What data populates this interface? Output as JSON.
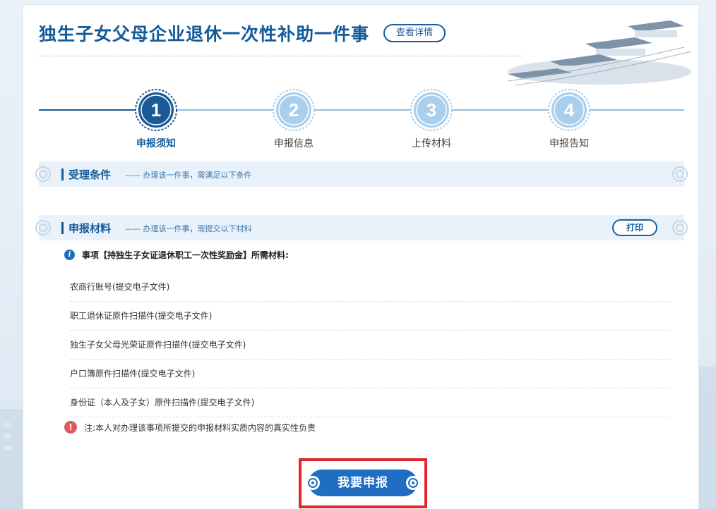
{
  "page": {
    "title": "独生子女父母企业退休一次性补助一件事",
    "detail_button": "查看详情"
  },
  "steps": [
    {
      "number": "1",
      "label": "申报须知",
      "active": true
    },
    {
      "number": "2",
      "label": "申报信息",
      "active": false
    },
    {
      "number": "3",
      "label": "上传材料",
      "active": false
    },
    {
      "number": "4",
      "label": "申报告知",
      "active": false
    }
  ],
  "conditions": {
    "title": "受理条件",
    "description": "—— 办理该一件事，需满足以下条件"
  },
  "materials": {
    "title": "申报材料",
    "description": "—— 办理该一件事，需提交以下材料",
    "print_button": "打印",
    "item_header": "事项【持独生子女证退休职工一次性奖励金】所需材料:",
    "items": [
      "农商行账号(提交电子文件)",
      "职工退休证原件扫描件(提交电子文件)",
      "独生子女父母光荣证原件扫描件(提交电子文件)",
      "户口簿原件扫描件(提交电子文件)",
      "身份证（本人及子女）原件扫描件(提交电子文件)"
    ],
    "note": "注:本人对办理该事项所提交的申报材料实质内容的真实性负责"
  },
  "apply_button": "我要申报",
  "colors": {
    "primary": "#145a99",
    "accent_blue": "#1f6ec2",
    "highlight_red": "#e3262b",
    "warn_red": "#e05a5a"
  },
  "icons": {
    "info": "info-icon",
    "warning": "exclamation-icon"
  }
}
